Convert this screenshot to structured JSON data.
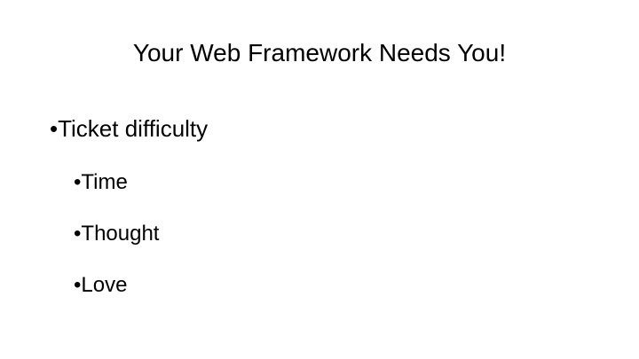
{
  "slide": {
    "title": "Your Web Framework Needs You!",
    "bullet_glyph": "•",
    "bullets": [
      {
        "text": "Ticket difficulty",
        "children": [
          {
            "text": "Time"
          },
          {
            "text": "Thought"
          },
          {
            "text": "Love"
          }
        ]
      }
    ]
  }
}
